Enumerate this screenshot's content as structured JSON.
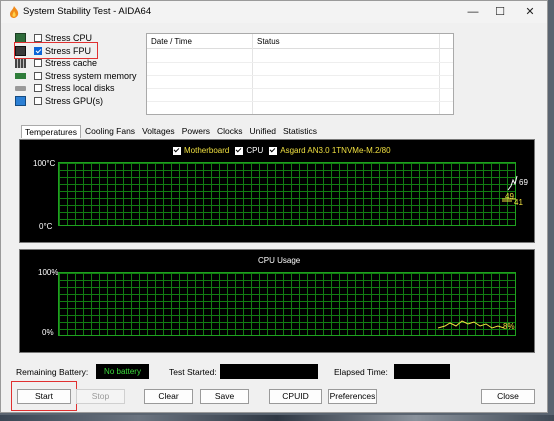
{
  "window": {
    "title": "System Stability Test - AIDA64"
  },
  "titlebar": {
    "minimize": "—",
    "maximize": "☐",
    "close": "✕"
  },
  "stress": [
    {
      "label": "Stress CPU",
      "checked": false,
      "icon": "cpu-chip-icon"
    },
    {
      "label": "Stress FPU",
      "checked": true,
      "icon": "fpu-chip-icon"
    },
    {
      "label": "Stress cache",
      "checked": false,
      "icon": "cache-icon"
    },
    {
      "label": "Stress system memory",
      "checked": false,
      "icon": "memory-icon"
    },
    {
      "label": "Stress local disks",
      "checked": false,
      "icon": "disk-icon"
    },
    {
      "label": "Stress GPU(s)",
      "checked": false,
      "icon": "gpu-icon"
    }
  ],
  "log": {
    "col_date": "Date / Time",
    "col_status": "Status"
  },
  "tabs": [
    "Temperatures",
    "Cooling Fans",
    "Voltages",
    "Powers",
    "Clocks",
    "Unified",
    "Statistics"
  ],
  "temp_graph": {
    "legend": [
      "Motherboard",
      "CPU",
      "Asgard AN3.0 1TNVMe-M.2/80"
    ],
    "y_top": "100°C",
    "y_bottom": "0°C",
    "readouts": [
      "69",
      "49",
      "41"
    ]
  },
  "cpu_graph": {
    "title": "CPU Usage",
    "y_top": "100%",
    "y_bottom": "0%",
    "readout": "8%"
  },
  "status": {
    "battery_label": "Remaining Battery:",
    "battery_value": "No battery",
    "started_label": "Test Started:",
    "elapsed_label": "Elapsed Time:"
  },
  "buttons": {
    "start": "Start",
    "stop": "Stop",
    "clear": "Clear",
    "save": "Save",
    "cpuid": "CPUID",
    "preferences": "Preferences",
    "close": "Close"
  },
  "colors": {
    "accent": "#0a64d8",
    "grid": "#127d12",
    "highlight": "#e03030"
  }
}
